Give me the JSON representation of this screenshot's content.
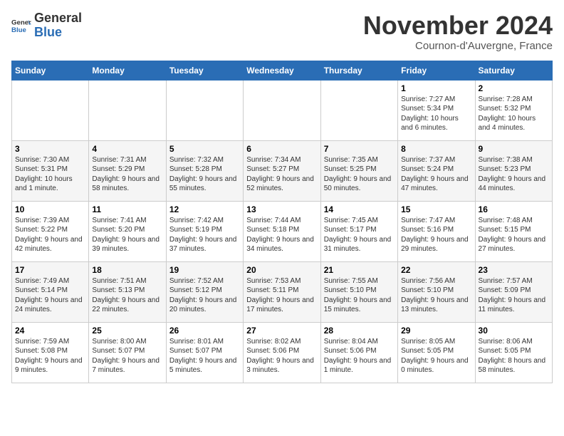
{
  "header": {
    "logo_general": "General",
    "logo_blue": "Blue",
    "month_title": "November 2024",
    "subtitle": "Cournon-d'Auvergne, France"
  },
  "days_of_week": [
    "Sunday",
    "Monday",
    "Tuesday",
    "Wednesday",
    "Thursday",
    "Friday",
    "Saturday"
  ],
  "weeks": [
    [
      {
        "day": "",
        "info": ""
      },
      {
        "day": "",
        "info": ""
      },
      {
        "day": "",
        "info": ""
      },
      {
        "day": "",
        "info": ""
      },
      {
        "day": "",
        "info": ""
      },
      {
        "day": "1",
        "info": "Sunrise: 7:27 AM\nSunset: 5:34 PM\nDaylight: 10 hours and 6 minutes."
      },
      {
        "day": "2",
        "info": "Sunrise: 7:28 AM\nSunset: 5:32 PM\nDaylight: 10 hours and 4 minutes."
      }
    ],
    [
      {
        "day": "3",
        "info": "Sunrise: 7:30 AM\nSunset: 5:31 PM\nDaylight: 10 hours and 1 minute."
      },
      {
        "day": "4",
        "info": "Sunrise: 7:31 AM\nSunset: 5:29 PM\nDaylight: 9 hours and 58 minutes."
      },
      {
        "day": "5",
        "info": "Sunrise: 7:32 AM\nSunset: 5:28 PM\nDaylight: 9 hours and 55 minutes."
      },
      {
        "day": "6",
        "info": "Sunrise: 7:34 AM\nSunset: 5:27 PM\nDaylight: 9 hours and 52 minutes."
      },
      {
        "day": "7",
        "info": "Sunrise: 7:35 AM\nSunset: 5:25 PM\nDaylight: 9 hours and 50 minutes."
      },
      {
        "day": "8",
        "info": "Sunrise: 7:37 AM\nSunset: 5:24 PM\nDaylight: 9 hours and 47 minutes."
      },
      {
        "day": "9",
        "info": "Sunrise: 7:38 AM\nSunset: 5:23 PM\nDaylight: 9 hours and 44 minutes."
      }
    ],
    [
      {
        "day": "10",
        "info": "Sunrise: 7:39 AM\nSunset: 5:22 PM\nDaylight: 9 hours and 42 minutes."
      },
      {
        "day": "11",
        "info": "Sunrise: 7:41 AM\nSunset: 5:20 PM\nDaylight: 9 hours and 39 minutes."
      },
      {
        "day": "12",
        "info": "Sunrise: 7:42 AM\nSunset: 5:19 PM\nDaylight: 9 hours and 37 minutes."
      },
      {
        "day": "13",
        "info": "Sunrise: 7:44 AM\nSunset: 5:18 PM\nDaylight: 9 hours and 34 minutes."
      },
      {
        "day": "14",
        "info": "Sunrise: 7:45 AM\nSunset: 5:17 PM\nDaylight: 9 hours and 31 minutes."
      },
      {
        "day": "15",
        "info": "Sunrise: 7:47 AM\nSunset: 5:16 PM\nDaylight: 9 hours and 29 minutes."
      },
      {
        "day": "16",
        "info": "Sunrise: 7:48 AM\nSunset: 5:15 PM\nDaylight: 9 hours and 27 minutes."
      }
    ],
    [
      {
        "day": "17",
        "info": "Sunrise: 7:49 AM\nSunset: 5:14 PM\nDaylight: 9 hours and 24 minutes."
      },
      {
        "day": "18",
        "info": "Sunrise: 7:51 AM\nSunset: 5:13 PM\nDaylight: 9 hours and 22 minutes."
      },
      {
        "day": "19",
        "info": "Sunrise: 7:52 AM\nSunset: 5:12 PM\nDaylight: 9 hours and 20 minutes."
      },
      {
        "day": "20",
        "info": "Sunrise: 7:53 AM\nSunset: 5:11 PM\nDaylight: 9 hours and 17 minutes."
      },
      {
        "day": "21",
        "info": "Sunrise: 7:55 AM\nSunset: 5:10 PM\nDaylight: 9 hours and 15 minutes."
      },
      {
        "day": "22",
        "info": "Sunrise: 7:56 AM\nSunset: 5:10 PM\nDaylight: 9 hours and 13 minutes."
      },
      {
        "day": "23",
        "info": "Sunrise: 7:57 AM\nSunset: 5:09 PM\nDaylight: 9 hours and 11 minutes."
      }
    ],
    [
      {
        "day": "24",
        "info": "Sunrise: 7:59 AM\nSunset: 5:08 PM\nDaylight: 9 hours and 9 minutes."
      },
      {
        "day": "25",
        "info": "Sunrise: 8:00 AM\nSunset: 5:07 PM\nDaylight: 9 hours and 7 minutes."
      },
      {
        "day": "26",
        "info": "Sunrise: 8:01 AM\nSunset: 5:07 PM\nDaylight: 9 hours and 5 minutes."
      },
      {
        "day": "27",
        "info": "Sunrise: 8:02 AM\nSunset: 5:06 PM\nDaylight: 9 hours and 3 minutes."
      },
      {
        "day": "28",
        "info": "Sunrise: 8:04 AM\nSunset: 5:06 PM\nDaylight: 9 hours and 1 minute."
      },
      {
        "day": "29",
        "info": "Sunrise: 8:05 AM\nSunset: 5:05 PM\nDaylight: 9 hours and 0 minutes."
      },
      {
        "day": "30",
        "info": "Sunrise: 8:06 AM\nSunset: 5:05 PM\nDaylight: 8 hours and 58 minutes."
      }
    ]
  ]
}
